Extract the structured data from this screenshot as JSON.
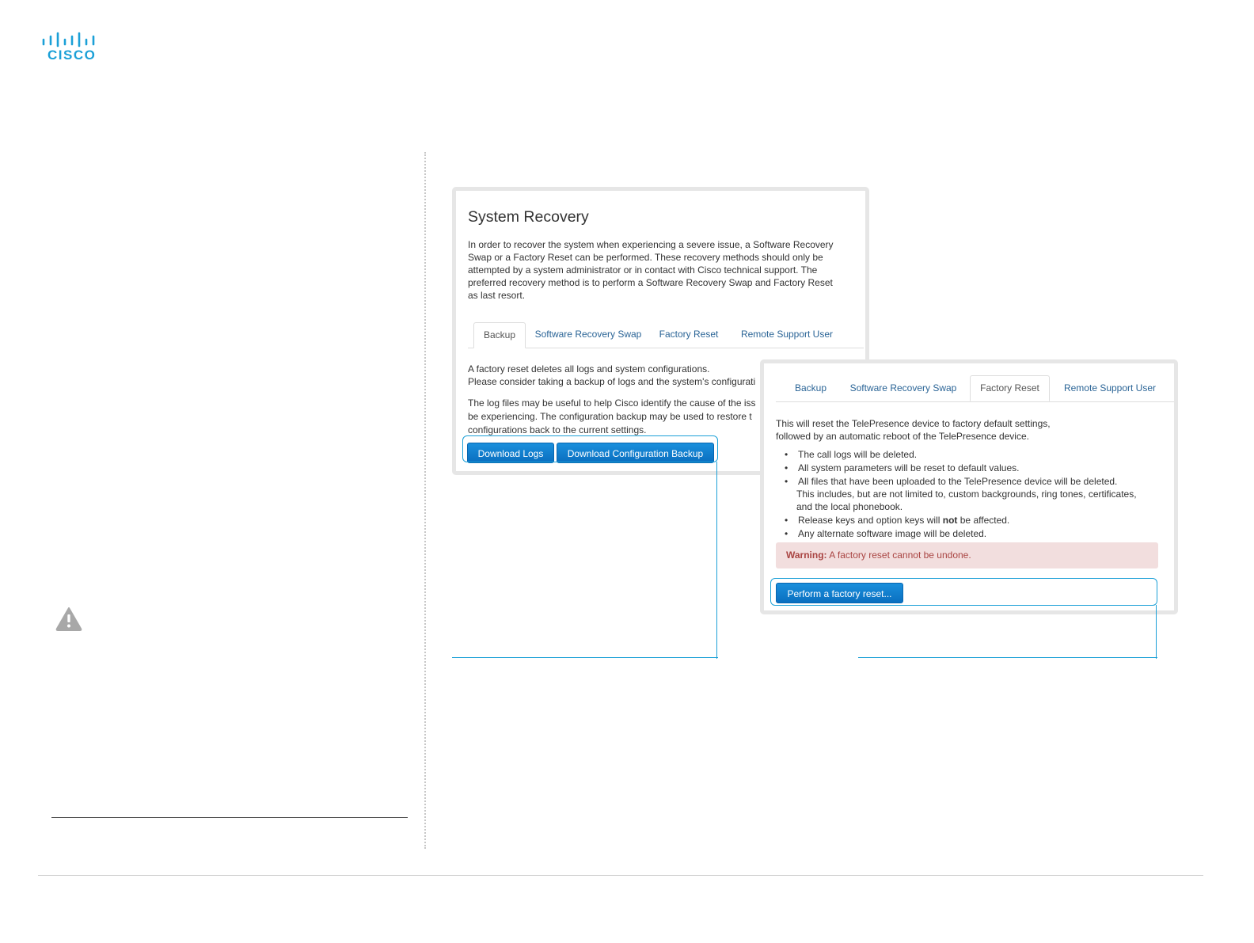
{
  "brand": {
    "logo_text": "CISCO",
    "color": "#1ba0d7"
  },
  "icons": {
    "warning": "warning-triangle-icon",
    "logo_bars": "cisco-bars-icon"
  },
  "panel1": {
    "title": "System Recovery",
    "intro": "In order to recover the system when experiencing a severe issue, a Software Recovery Swap or a Factory Reset can be performed. These recovery methods should only be attempted by a system administrator or in contact with Cisco technical support. The preferred recovery method is to perform a Software Recovery Swap and Factory Reset as last resort.",
    "tabs": [
      "Backup",
      "Software Recovery Swap",
      "Factory Reset",
      "Remote Support User"
    ],
    "active_tab": "Backup",
    "body_line1": "A factory reset deletes all logs and system configurations.",
    "body_line2": "Please consider taking a backup of logs and the system's configurati",
    "body_line3": "The log files may be useful to help Cisco identify the cause of the iss",
    "body_line4": " be experiencing. The configuration backup may be used to restore t",
    "body_line5": "configurations back to the current settings.",
    "btn_download_logs": "Download Logs",
    "btn_download_config": "Download Configuration Backup"
  },
  "panel2": {
    "tabs": [
      "Backup",
      "Software Recovery Swap",
      "Factory Reset",
      "Remote Support User"
    ],
    "active_tab": "Factory Reset",
    "intro_line1": "This will reset the TelePresence device to factory default settings,",
    "intro_line2": "followed by an automatic reboot of the TelePresence device.",
    "list": {
      "item1": "The call logs will be deleted.",
      "item2": "All system parameters will be reset to default values.",
      "item3": "All files that have been uploaded to the TelePresence device will be deleted.",
      "item3_sub1": "This includes, but are not limited to, custom backgrounds, ring tones, certificates,",
      "item3_sub2": "and the local phonebook.",
      "item4_pre": "Release keys and option keys will ",
      "item4_bold": "not",
      "item4_post": " be affected.",
      "item5": "Any alternate software image will be deleted."
    },
    "warning_label": "Warning:",
    "warning_text": " A factory reset cannot be undone.",
    "btn_factory_reset": "Perform a factory reset..."
  }
}
